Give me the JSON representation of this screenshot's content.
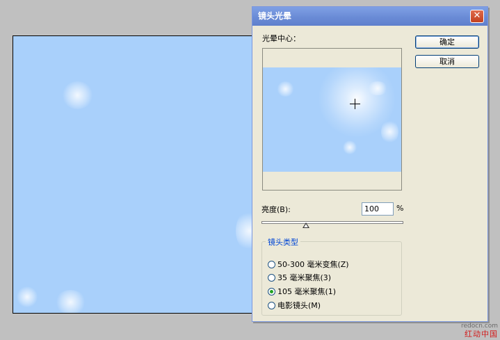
{
  "dialog": {
    "title": "镜头光晕",
    "close_symbol": "✕",
    "flare_center_label": "光晕中心：",
    "ok_label": "确定",
    "cancel_label": "取消",
    "brightness_label": "亮度(B):",
    "brightness_value": "100",
    "percent_symbol": "%",
    "brightness_slider_value": 100,
    "lens_type_title": "镜头类型",
    "lens_options": [
      {
        "label": "50-300 毫米变焦(Z)",
        "checked": false
      },
      {
        "label": "35 毫米聚焦(3)",
        "checked": false
      },
      {
        "label": "105 毫米聚焦(1)",
        "checked": true
      },
      {
        "label": "电影镜头(M)",
        "checked": false
      }
    ]
  },
  "watermark": {
    "url": "redocn.com",
    "name": "红动中国"
  },
  "icons": {
    "close": "close-icon",
    "crosshair": "crosshair-icon"
  }
}
